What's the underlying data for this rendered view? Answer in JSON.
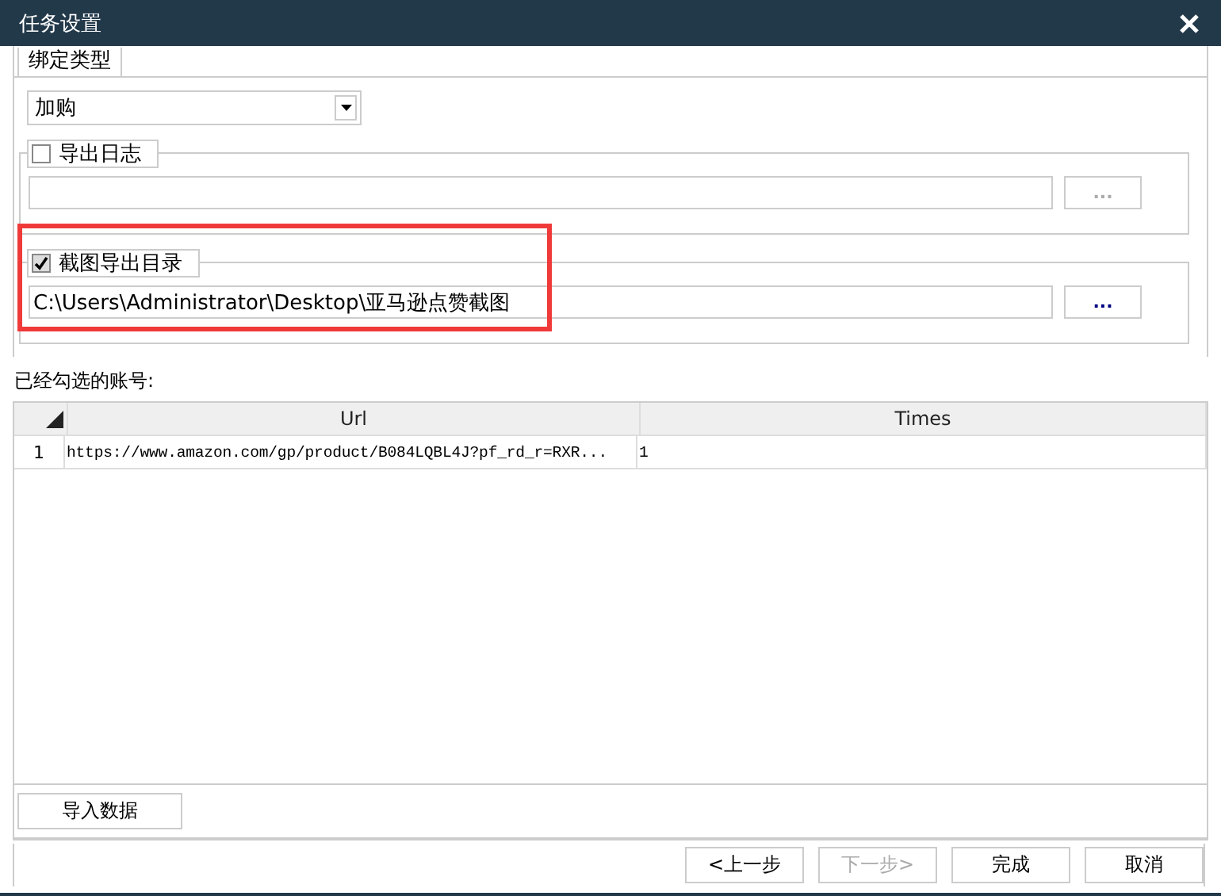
{
  "window": {
    "title": "任务设置"
  },
  "bind_type": {
    "legend": "绑定类型",
    "value": "加购"
  },
  "groups": [
    {
      "label": "导出日志",
      "checked": false,
      "highlighted": false,
      "browse": "...",
      "disabled": true
    },
    {
      "label": "截图导出目录",
      "checked": true,
      "highlighted": true,
      "path": "C:\\Users\\Administrator\\Desktop\\亚马逊点赞截图",
      "browse": "...",
      "disabled": false
    }
  ],
  "accounts_label": "已经勾选的账号:",
  "table": {
    "columns": [
      "Url",
      "Times"
    ],
    "rows": [
      {
        "index": "1",
        "cells": [
          "https://www.amazon.com/gp/product/B084LQBL4J?pf_rd_r=RXR...",
          "1"
        ]
      }
    ]
  },
  "import_button": "导入数据",
  "buttons": [
    {
      "label": "<上一步",
      "disabled": false
    },
    {
      "label": "下一步>",
      "disabled": true
    },
    {
      "label": "完成",
      "disabled": false
    },
    {
      "label": "取消",
      "disabled": false
    }
  ]
}
